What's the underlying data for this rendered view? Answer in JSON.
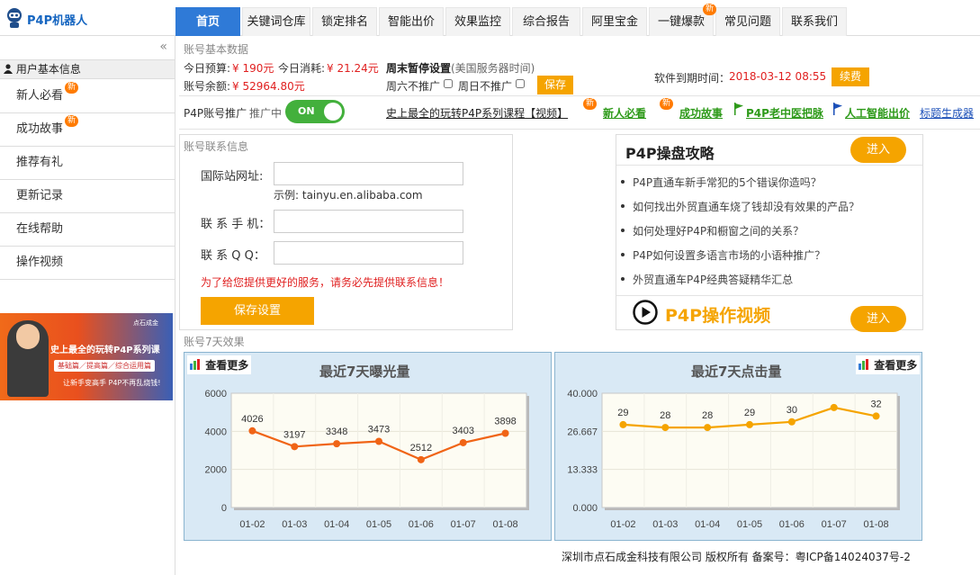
{
  "app": {
    "name": "P4P机器人"
  },
  "nav": {
    "items": [
      "首页",
      "关键词仓库",
      "锁定排名",
      "智能出价",
      "效果监控",
      "综合报告",
      "阿里宝金",
      "一键爆款",
      "常见问题",
      "联系我们"
    ],
    "new_badge": "新"
  },
  "sidebar": {
    "collapse": "«",
    "header": "用户基本信息",
    "items": [
      "新人必看",
      "成功故事",
      "推荐有礼",
      "更新记录",
      "在线帮助",
      "操作视频"
    ],
    "new_badge": "新",
    "banner": {
      "title": "史上最全的玩转P4P系列课",
      "subtitle": "基础篇／提高篇／综合运用篇",
      "tagline": "让新手变高手 P4P不再乱烧钱!",
      "brand": "点石成金"
    }
  },
  "account": {
    "section_label": "账号基本数据",
    "budget_label": "今日预算:",
    "budget_value": "¥ 190元",
    "spend_label": "今日消耗:",
    "spend_value": "¥ 21.24元",
    "balance_label": "账号余额:",
    "balance_value": "¥ 52964.80元",
    "weekend_title": "周末暂停设置",
    "weekend_note": "(美国服务器时间)",
    "saturday": "周六不推广",
    "sunday": "周日不推广",
    "save_label": "保存",
    "expire_label": "软件到期时间：",
    "expire_value": "2018-03-12 08:55",
    "renew_label": "续费"
  },
  "promo": {
    "label": "P4P账号推广",
    "status": "推广中",
    "toggle": "ON",
    "course_link": "史上最全的玩转P4P系列课程【视频】",
    "new_badge": "新",
    "links": [
      "新人必看",
      "成功故事",
      "P4P老中医把脉",
      "人工智能出价",
      "标题生成器"
    ]
  },
  "contact": {
    "section_label": "账号联系信息",
    "site_label": "国际站网址:",
    "site_hint": "示例: tainyu.en.alibaba.com",
    "phone_label": "联 系 手 机：",
    "qq_label": "联 系 Q Q：",
    "warning": "为了给您提供更好的服务，请务必先提供联系信息！",
    "save_label": "保存设置"
  },
  "guide": {
    "title": "P4P操盘攻略",
    "enter_label": "进入",
    "items": [
      "P4P直通车新手常犯的5个错误你造吗？",
      "如何找出外贸直通车烧了钱却没有效果的产品？",
      "如何处理好P4P和橱窗之间的关系？",
      "P4P如何设置多语言市场的小语种推广？",
      "外贸直通车P4P经典答疑精华汇总"
    ],
    "video_label": "P4P操作视频",
    "video_enter_label": "进入"
  },
  "effect": {
    "section_label": "账号7天效果",
    "more_label": "查看更多"
  },
  "chart_data": [
    {
      "type": "line",
      "title": "最近7天曝光量",
      "categories": [
        "01-02",
        "01-03",
        "01-04",
        "01-05",
        "01-06",
        "01-07",
        "01-08"
      ],
      "values": [
        4026,
        3197,
        3348,
        3473,
        2512,
        3403,
        3898
      ],
      "ylim": [
        0,
        6000
      ],
      "yticks": [
        "0",
        "2000",
        "4000",
        "6000"
      ],
      "color": "#f06416",
      "grid": true
    },
    {
      "type": "line",
      "title": "最近7天点击量",
      "categories": [
        "01-02",
        "01-03",
        "01-04",
        "01-05",
        "01-06",
        "01-07",
        "01-08"
      ],
      "values": [
        29,
        28,
        28,
        29,
        30,
        35,
        32
      ],
      "labels": [
        "29",
        "28",
        "28",
        "29",
        "30",
        "",
        "32"
      ],
      "ylim": [
        0,
        40
      ],
      "yticks": [
        "0.000",
        "13.333",
        "26.667",
        "40.000"
      ],
      "color": "#f5a400",
      "grid": true
    }
  ],
  "footer": {
    "text": "深圳市点石成金科技有限公司 版权所有 备案号：粤ICP备14024037号-2"
  }
}
